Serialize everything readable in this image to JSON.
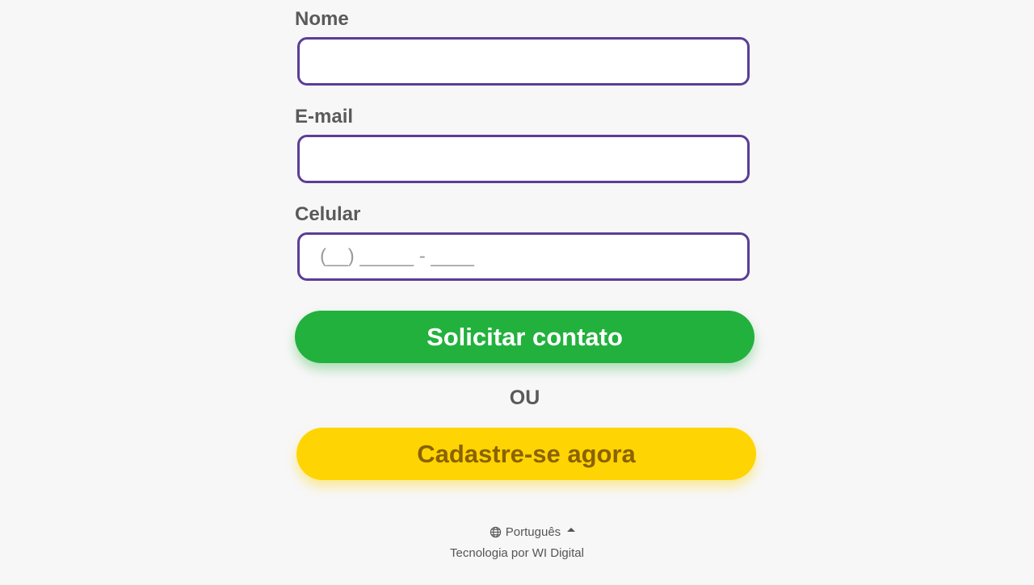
{
  "form": {
    "name_label": "Nome",
    "email_label": "E-mail",
    "phone_label": "Celular",
    "name_value": "",
    "email_value": "",
    "phone_placeholder": "(__) _____ - ____"
  },
  "actions": {
    "request_contact_label": "Solicitar contato",
    "or_label": "OU",
    "signup_label": "Cadastre-se agora"
  },
  "footer": {
    "language_label": "Português",
    "credit": "Tecnologia por WI Digital"
  },
  "colors": {
    "field_border": "#5b3d96",
    "primary_button": "#22b13d",
    "secondary_button": "#ffd403",
    "secondary_text": "#8a6200"
  },
  "icons": {
    "language": "globe-icon",
    "dropdown": "caret-up-icon"
  }
}
